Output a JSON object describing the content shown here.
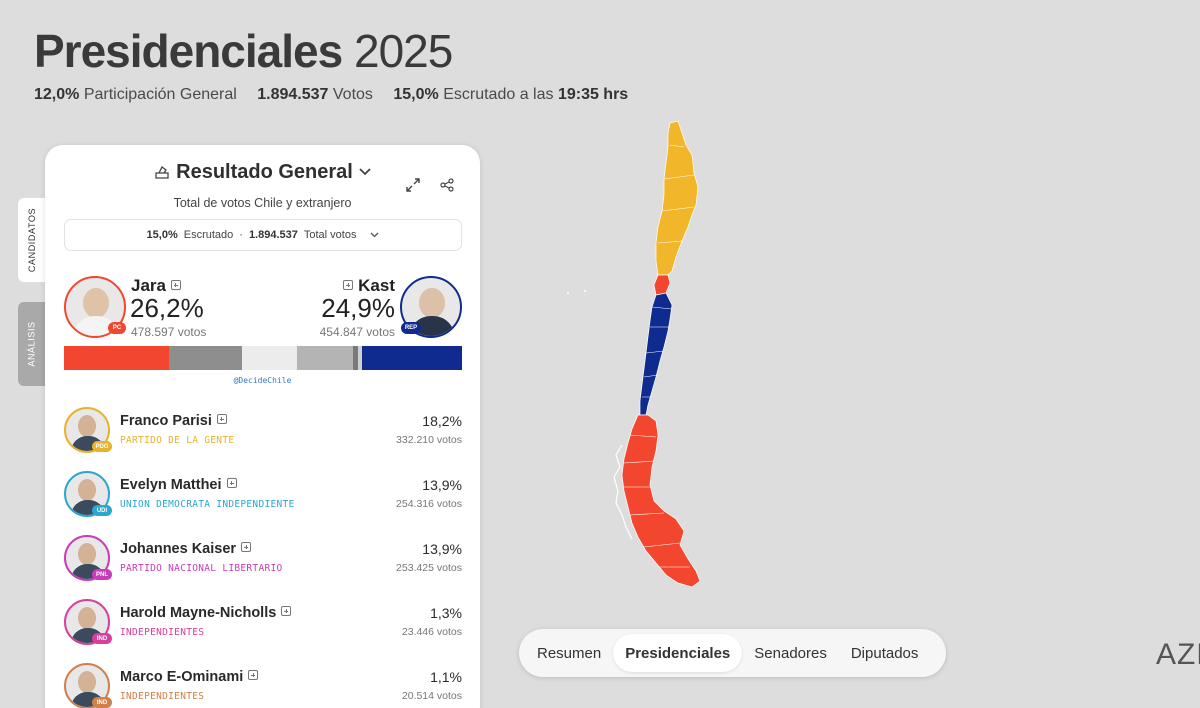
{
  "header": {
    "title_bold": "Presidenciales",
    "title_year": "2025",
    "stats": [
      {
        "value": "12,0%",
        "label": "Participación General"
      },
      {
        "value": "1.894.537",
        "label": "Votos"
      },
      {
        "value": "15,0%",
        "label": "Escrutado a las",
        "time": "19:35 hrs"
      }
    ]
  },
  "side_tabs": [
    "CANDIDATOS",
    "ANÁLISIS"
  ],
  "card": {
    "title": "Resultado General",
    "subtitle": "Total de votos Chile y extranjero",
    "counter": {
      "pct": "15,0%",
      "pct_label": "Escrutado",
      "dot": "·",
      "votes": "1.894.537",
      "votes_label": "Total votos"
    },
    "leaders": [
      {
        "name": "Jara",
        "pct": "26,2%",
        "votes": "478.597 votos",
        "party": "PC",
        "color": "#f2472e"
      },
      {
        "name": "Kast",
        "pct": "24,9%",
        "votes": "454.847 votos",
        "party": "REP",
        "color": "#0f2b8f"
      }
    ],
    "bar": [
      {
        "share": 26.2,
        "color": "#f2472e"
      },
      {
        "share": 18.2,
        "color": "#8e8e8e"
      },
      {
        "share": 13.9,
        "color": "#ececec"
      },
      {
        "share": 13.9,
        "color": "#b4b4b4"
      },
      {
        "share": 1.3,
        "color": "#7a7a7a"
      },
      {
        "share": 1.1,
        "color": "#d0d0d0"
      },
      {
        "share": 24.9,
        "color": "#0f2b8f"
      }
    ],
    "handle": "@DecideChile",
    "candidates": [
      {
        "name": "Franco Parisi",
        "party": "PARTIDO DE LA GENTE",
        "pct": "18,2%",
        "votes": "332.210 votos",
        "badge": "PDG",
        "color": "#e8b22a"
      },
      {
        "name": "Evelyn Matthei",
        "party": "UNION DEMOCRATA INDEPENDIENTE",
        "pct": "13,9%",
        "votes": "254.316 votos",
        "badge": "UDI",
        "color": "#2aa6cf"
      },
      {
        "name": "Johannes Kaiser",
        "party": "PARTIDO NACIONAL LIBERTARIO",
        "pct": "13,9%",
        "votes": "253.425 votos",
        "badge": "PNL",
        "color": "#c93bb8"
      },
      {
        "name": "Harold Mayne-Nicholls",
        "party": "INDEPENDIENTES",
        "pct": "1,3%",
        "votes": "23.446 votos",
        "badge": "IND",
        "color": "#d83e9c"
      },
      {
        "name": "Marco E-Ominami",
        "party": "INDEPENDIENTES",
        "pct": "1,1%",
        "votes": "20.514 votos",
        "badge": "IND",
        "color": "#d0804a"
      }
    ]
  },
  "nav": {
    "items": [
      "Resumen",
      "Presidenciales",
      "Senadores",
      "Diputados"
    ],
    "active": "Presidenciales"
  },
  "corner_logo": "AZE",
  "map_colors": {
    "north": "#f2b62b",
    "center": "#0f2b8f",
    "south": "#f2472e",
    "pc_red": "#f2472e"
  }
}
